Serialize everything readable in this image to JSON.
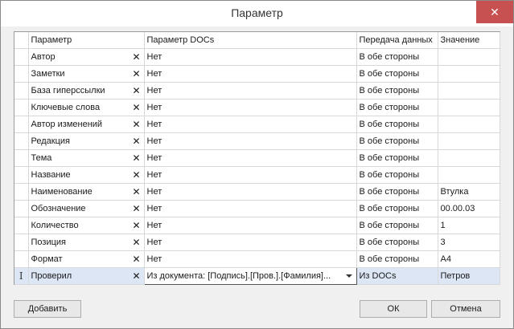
{
  "window": {
    "title": "Параметр",
    "close_glyph": "✕"
  },
  "table": {
    "columns": [
      "Параметр",
      "Параметр DOCs",
      "Передача данных",
      "Значение"
    ],
    "rows": [
      {
        "param": "Автор",
        "docs": "Нет",
        "transfer": "В обе стороны",
        "value": ""
      },
      {
        "param": "Заметки",
        "docs": "Нет",
        "transfer": "В обе стороны",
        "value": ""
      },
      {
        "param": "База гиперссылки",
        "docs": "Нет",
        "transfer": "В обе стороны",
        "value": ""
      },
      {
        "param": "Ключевые слова",
        "docs": "Нет",
        "transfer": "В обе стороны",
        "value": ""
      },
      {
        "param": "Автор изменений",
        "docs": "Нет",
        "transfer": "В обе стороны",
        "value": ""
      },
      {
        "param": "Редакция",
        "docs": "Нет",
        "transfer": "В обе стороны",
        "value": ""
      },
      {
        "param": "Тема",
        "docs": "Нет",
        "transfer": "В обе стороны",
        "value": ""
      },
      {
        "param": "Название",
        "docs": "Нет",
        "transfer": "В обе стороны",
        "value": ""
      },
      {
        "param": "Наименование",
        "docs": "Нет",
        "transfer": "В обе стороны",
        "value": "Втулка"
      },
      {
        "param": "Обозначение",
        "docs": "Нет",
        "transfer": "В обе стороны",
        "value": "00.00.03"
      },
      {
        "param": "Количество",
        "docs": "Нет",
        "transfer": "В обе стороны",
        "value": "1"
      },
      {
        "param": "Позиция",
        "docs": "Нет",
        "transfer": "В обе стороны",
        "value": "3"
      },
      {
        "param": "Формат",
        "docs": "Нет",
        "transfer": "В обе стороны",
        "value": "А4"
      },
      {
        "param": "Проверил",
        "docs": "Из документа: [Подпись].[Пров.].[Фамилия]...",
        "transfer": "Из DOCs",
        "value": "Петров"
      }
    ],
    "remove_glyph": "✕",
    "edit_cursor_glyph": "I"
  },
  "buttons": {
    "add": "Добавить",
    "ok": "ОК",
    "cancel": "Отмена"
  }
}
